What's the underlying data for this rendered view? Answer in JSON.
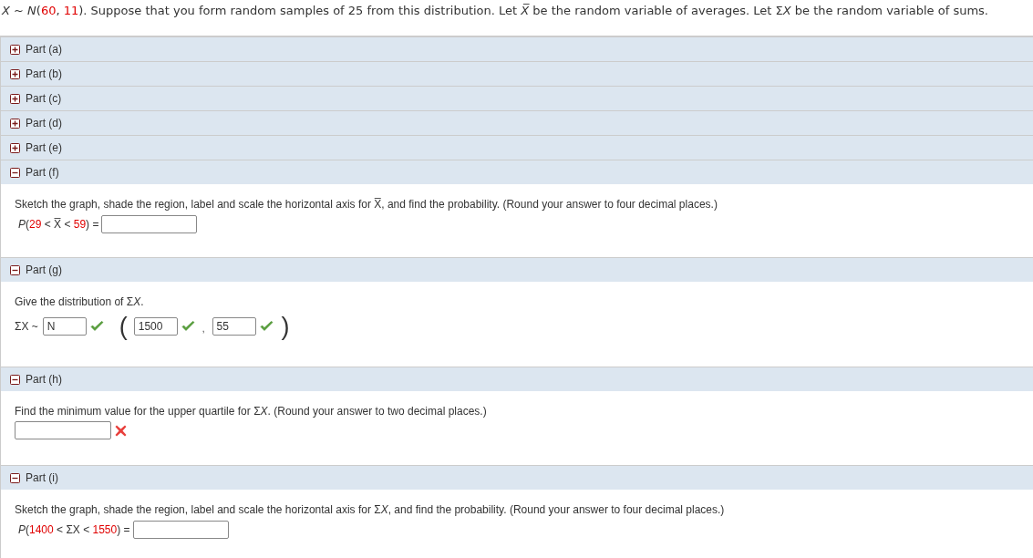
{
  "intro": [
    {
      "text": "X",
      "kind": "italic"
    },
    {
      "text": " ~ ",
      "kind": "text"
    },
    {
      "text": "N",
      "kind": "italic"
    },
    {
      "text": "(",
      "kind": "text"
    },
    {
      "text": "60",
      "kind": "number"
    },
    {
      "text": ", ",
      "kind": "text"
    },
    {
      "text": "11",
      "kind": "number"
    },
    {
      "text": "). Suppose that you form random samples of 25 from this distribution. Let ",
      "kind": "text"
    },
    {
      "text": "X̅",
      "kind": "italic"
    },
    {
      "text": " be the random variable of averages. Let Σ",
      "kind": "text"
    },
    {
      "text": "X",
      "kind": "italic"
    },
    {
      "text": " be the random variable of sums.",
      "kind": "text"
    }
  ],
  "parts": [
    {
      "label": "Part (a)",
      "expanded": false
    },
    {
      "label": "Part (b)",
      "expanded": false
    },
    {
      "label": "Part (c)",
      "expanded": false
    },
    {
      "label": "Part (d)",
      "expanded": false
    },
    {
      "label": "Part (e)",
      "expanded": false
    },
    {
      "label": "Part (f)",
      "expanded": true,
      "body": {
        "kind": "probability",
        "instruction": [
          {
            "text": "Sketch the graph, shade the region, label and scale the horizontal axis for X̅, and find the probability. (Round your answer to four decimal places.)",
            "kind": "text"
          }
        ],
        "prompt": [
          {
            "text": "P",
            "kind": "italic"
          },
          {
            "text": "(",
            "kind": "text"
          },
          {
            "text": "29",
            "kind": "number"
          },
          {
            "text": " < X̅ < ",
            "kind": "text"
          },
          {
            "text": "59",
            "kind": "number"
          },
          {
            "text": ") =",
            "kind": "text"
          }
        ]
      }
    },
    {
      "label": "Part (g)",
      "expanded": true,
      "body": {
        "kind": "distribution",
        "instruction": [
          {
            "text": "Give the distribution of Σ",
            "kind": "text"
          },
          {
            "text": "X",
            "kind": "italic"
          },
          {
            "text": ".",
            "kind": "text"
          }
        ],
        "lead": "ΣX ~",
        "open": "(",
        "separator": ",",
        "close": ")",
        "fields": [
          {
            "value": "N",
            "correct": true
          },
          {
            "value": "1500",
            "correct": true
          },
          {
            "value": "55",
            "correct": true
          }
        ]
      }
    },
    {
      "label": "Part (h)",
      "expanded": true,
      "body": {
        "kind": "value",
        "instruction": [
          {
            "text": "Find the minimum value for the upper quartile for Σ",
            "kind": "text"
          },
          {
            "text": "X",
            "kind": "italic"
          },
          {
            "text": ". (Round your answer to two decimal places.)",
            "kind": "text"
          }
        ],
        "fields": [
          {
            "correct": false
          }
        ]
      }
    },
    {
      "label": "Part (i)",
      "expanded": true,
      "body": {
        "kind": "probability",
        "instruction": [
          {
            "text": "Sketch the graph, shade the region, label and scale the horizontal axis for Σ",
            "kind": "text"
          },
          {
            "text": "X",
            "kind": "italic"
          },
          {
            "text": ", and find the probability. (Round your answer to four decimal places.)",
            "kind": "text"
          }
        ],
        "prompt": [
          {
            "text": "P",
            "kind": "italic"
          },
          {
            "text": "(",
            "kind": "text"
          },
          {
            "text": "1400",
            "kind": "number"
          },
          {
            "text": " < ΣX < ",
            "kind": "text"
          },
          {
            "text": "1550",
            "kind": "number"
          },
          {
            "text": ") =",
            "kind": "text"
          }
        ]
      }
    }
  ]
}
